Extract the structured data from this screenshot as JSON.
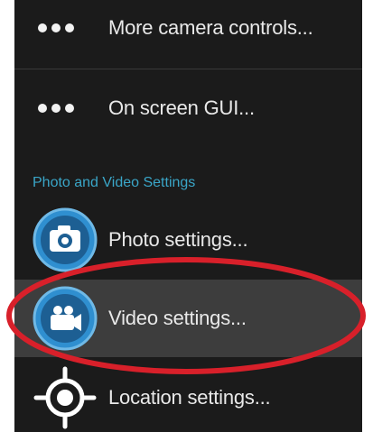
{
  "menu": {
    "items": [
      {
        "label": "More camera controls...",
        "icon": "more-dots-icon"
      },
      {
        "label": "On screen GUI...",
        "icon": "more-dots-icon"
      }
    ],
    "section_header": "Photo and Video Settings",
    "settings": [
      {
        "label": "Photo settings...",
        "icon": "camera-icon"
      },
      {
        "label": "Video settings...",
        "icon": "video-camera-icon",
        "highlighted": true
      },
      {
        "label": "Location settings...",
        "icon": "location-target-icon"
      }
    ]
  },
  "colors": {
    "background": "#1b1b1b",
    "accent": "#3aa6c8",
    "icon_blue": "#2f8fd0",
    "highlight": "#3d3d3d",
    "annotation_red": "#d8202a"
  }
}
